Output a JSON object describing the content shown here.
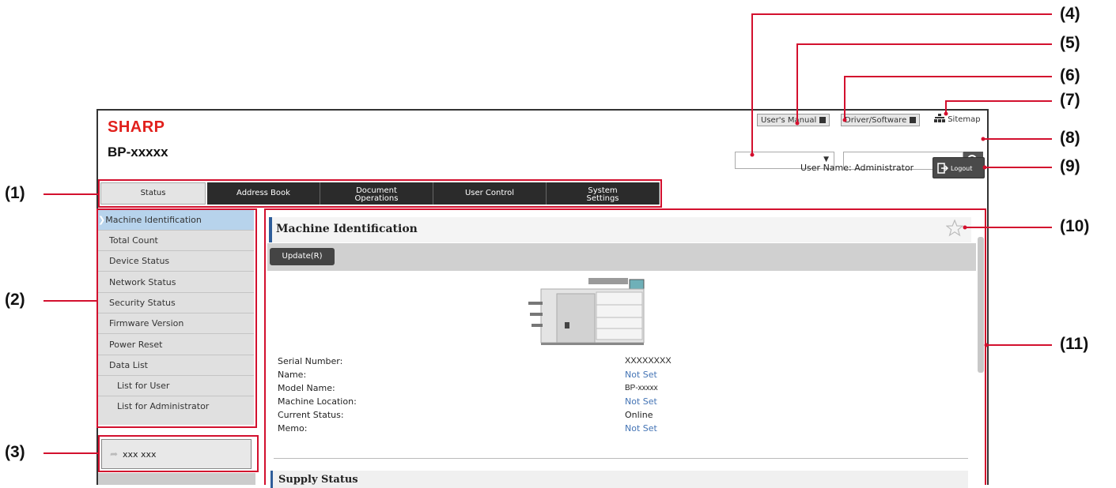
{
  "brand": {
    "logo": "SHARP",
    "model": "BP-xxxxx"
  },
  "header": {
    "users_manual": "User's Manual",
    "driver_software": "Driver/Software",
    "sitemap": "Sitemap",
    "language_value": "",
    "search_value": "",
    "user_name": "User Name: Administrator",
    "logout": "Logout"
  },
  "tabs": [
    {
      "label": "Status"
    },
    {
      "label": "Address Book"
    },
    {
      "label": "Document\nOperations"
    },
    {
      "label": "User Control"
    },
    {
      "label": "System\nSettings"
    }
  ],
  "side_menu": [
    {
      "label": "Machine Identification"
    },
    {
      "label": "Total Count"
    },
    {
      "label": "Device Status"
    },
    {
      "label": "Network Status"
    },
    {
      "label": "Security Status"
    },
    {
      "label": "Firmware Version"
    },
    {
      "label": "Power Reset"
    },
    {
      "label": "Data List"
    },
    {
      "label": "List for User"
    },
    {
      "label": "List for Administrator"
    }
  ],
  "bottom_link": "xxx xxx",
  "content": {
    "title": "Machine Identification",
    "update_button": "Update(R)",
    "fields": [
      {
        "label": "Serial Number:",
        "value": "XXXXXXXX"
      },
      {
        "label": "Name:",
        "value": "Not Set"
      },
      {
        "label": "Model Name:",
        "value": "BP-xxxxx"
      },
      {
        "label": "Machine Location:",
        "value": "Not Set"
      },
      {
        "label": "Current Status:",
        "value": "Online"
      },
      {
        "label": "Memo:",
        "value": "Not Set"
      }
    ],
    "supply_title": "Supply Status"
  },
  "callouts": [
    "(1)",
    "(2)",
    "(3)",
    "(4)",
    "(5)",
    "(6)",
    "(7)",
    "(8)",
    "(9)",
    "(10)",
    "(11)"
  ],
  "colors": {
    "brand_red": "#e1201c",
    "callout_red": "#d3102e",
    "accent_blue": "#2e5d9a",
    "link_blue": "#4474b5",
    "selected_item": "#b7d3ec"
  },
  "icons": [
    "external-link-icon",
    "sitemap-icon",
    "chevron-down-icon",
    "search-icon",
    "logout-icon",
    "star-icon",
    "printer-image",
    "arrow-icon"
  ]
}
